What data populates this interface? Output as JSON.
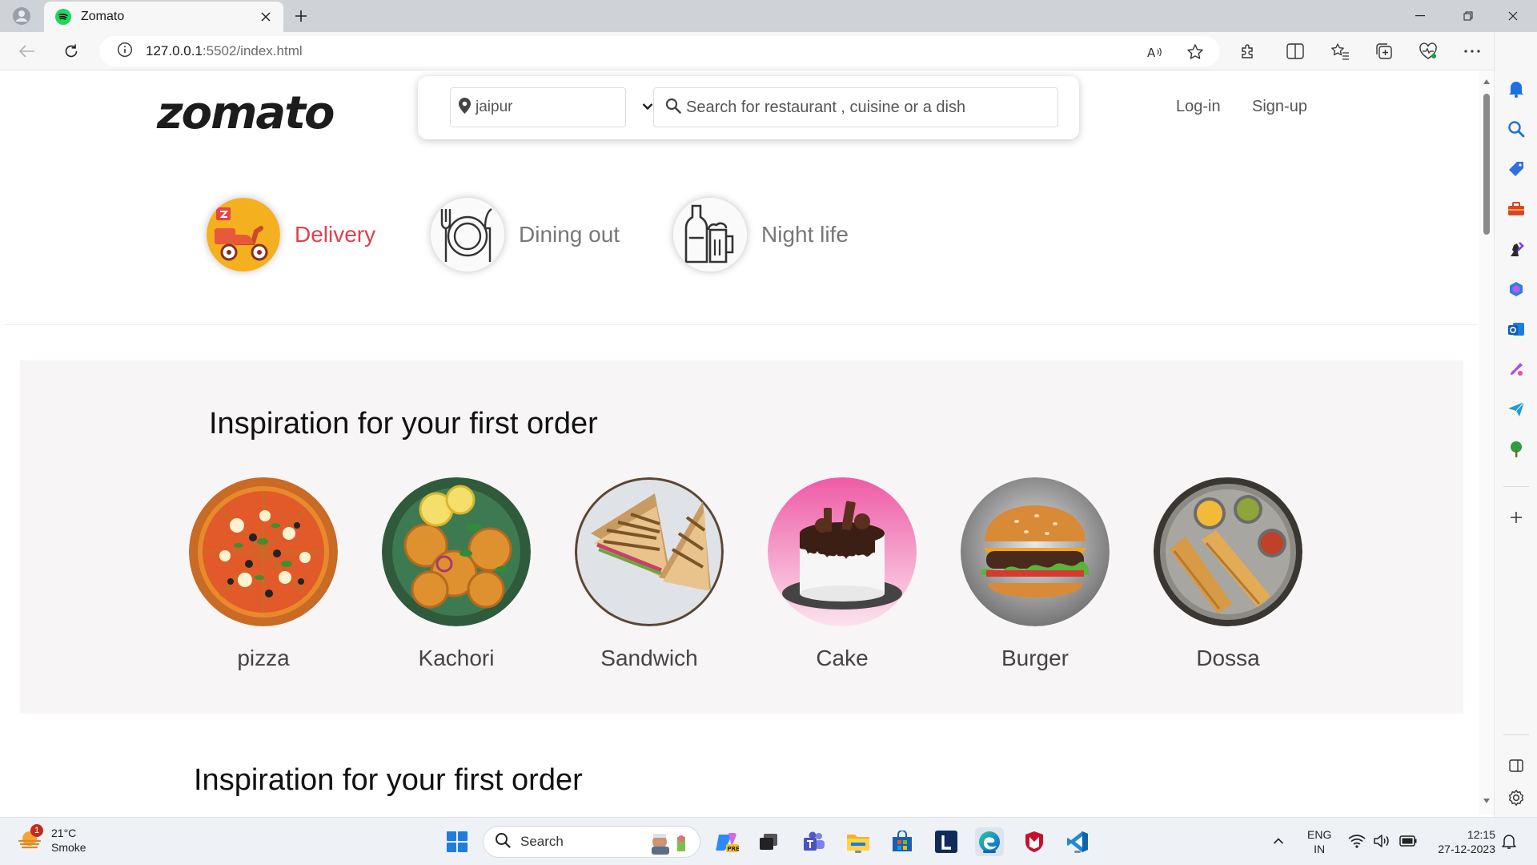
{
  "browser": {
    "tab_title": "Zomato",
    "url_host": "127.0.0.1",
    "url_rest": ":5502/index.html"
  },
  "header": {
    "logo": "zomato",
    "location_value": "jaipur",
    "search_placeholder": "Search for restaurant , cuisine or a dish",
    "login_label": "Log-in",
    "signup_label": "Sign-up"
  },
  "categories": [
    {
      "label": "Delivery",
      "icon": "scooter-icon"
    },
    {
      "label": "Dining out",
      "icon": "dining-icon"
    },
    {
      "label": "Night life",
      "icon": "nightlife-icon"
    }
  ],
  "inspiration": {
    "heading": "Inspiration for your first order",
    "items": [
      "pizza",
      "Kachori",
      "Sandwich",
      "Cake",
      "Burger",
      "Dossa"
    ]
  },
  "inspiration2": {
    "heading": "Inspiration for your first order"
  },
  "taskbar": {
    "temperature": "21°C",
    "condition": "Smoke",
    "notification_count": "1",
    "search_label": "Search",
    "lang_1": "ENG",
    "lang_2": "IN",
    "time": "12:15",
    "date": "27-12-2023"
  },
  "colors": {
    "brand_red": "#e0404d",
    "accent_blue": "#0067c0"
  }
}
